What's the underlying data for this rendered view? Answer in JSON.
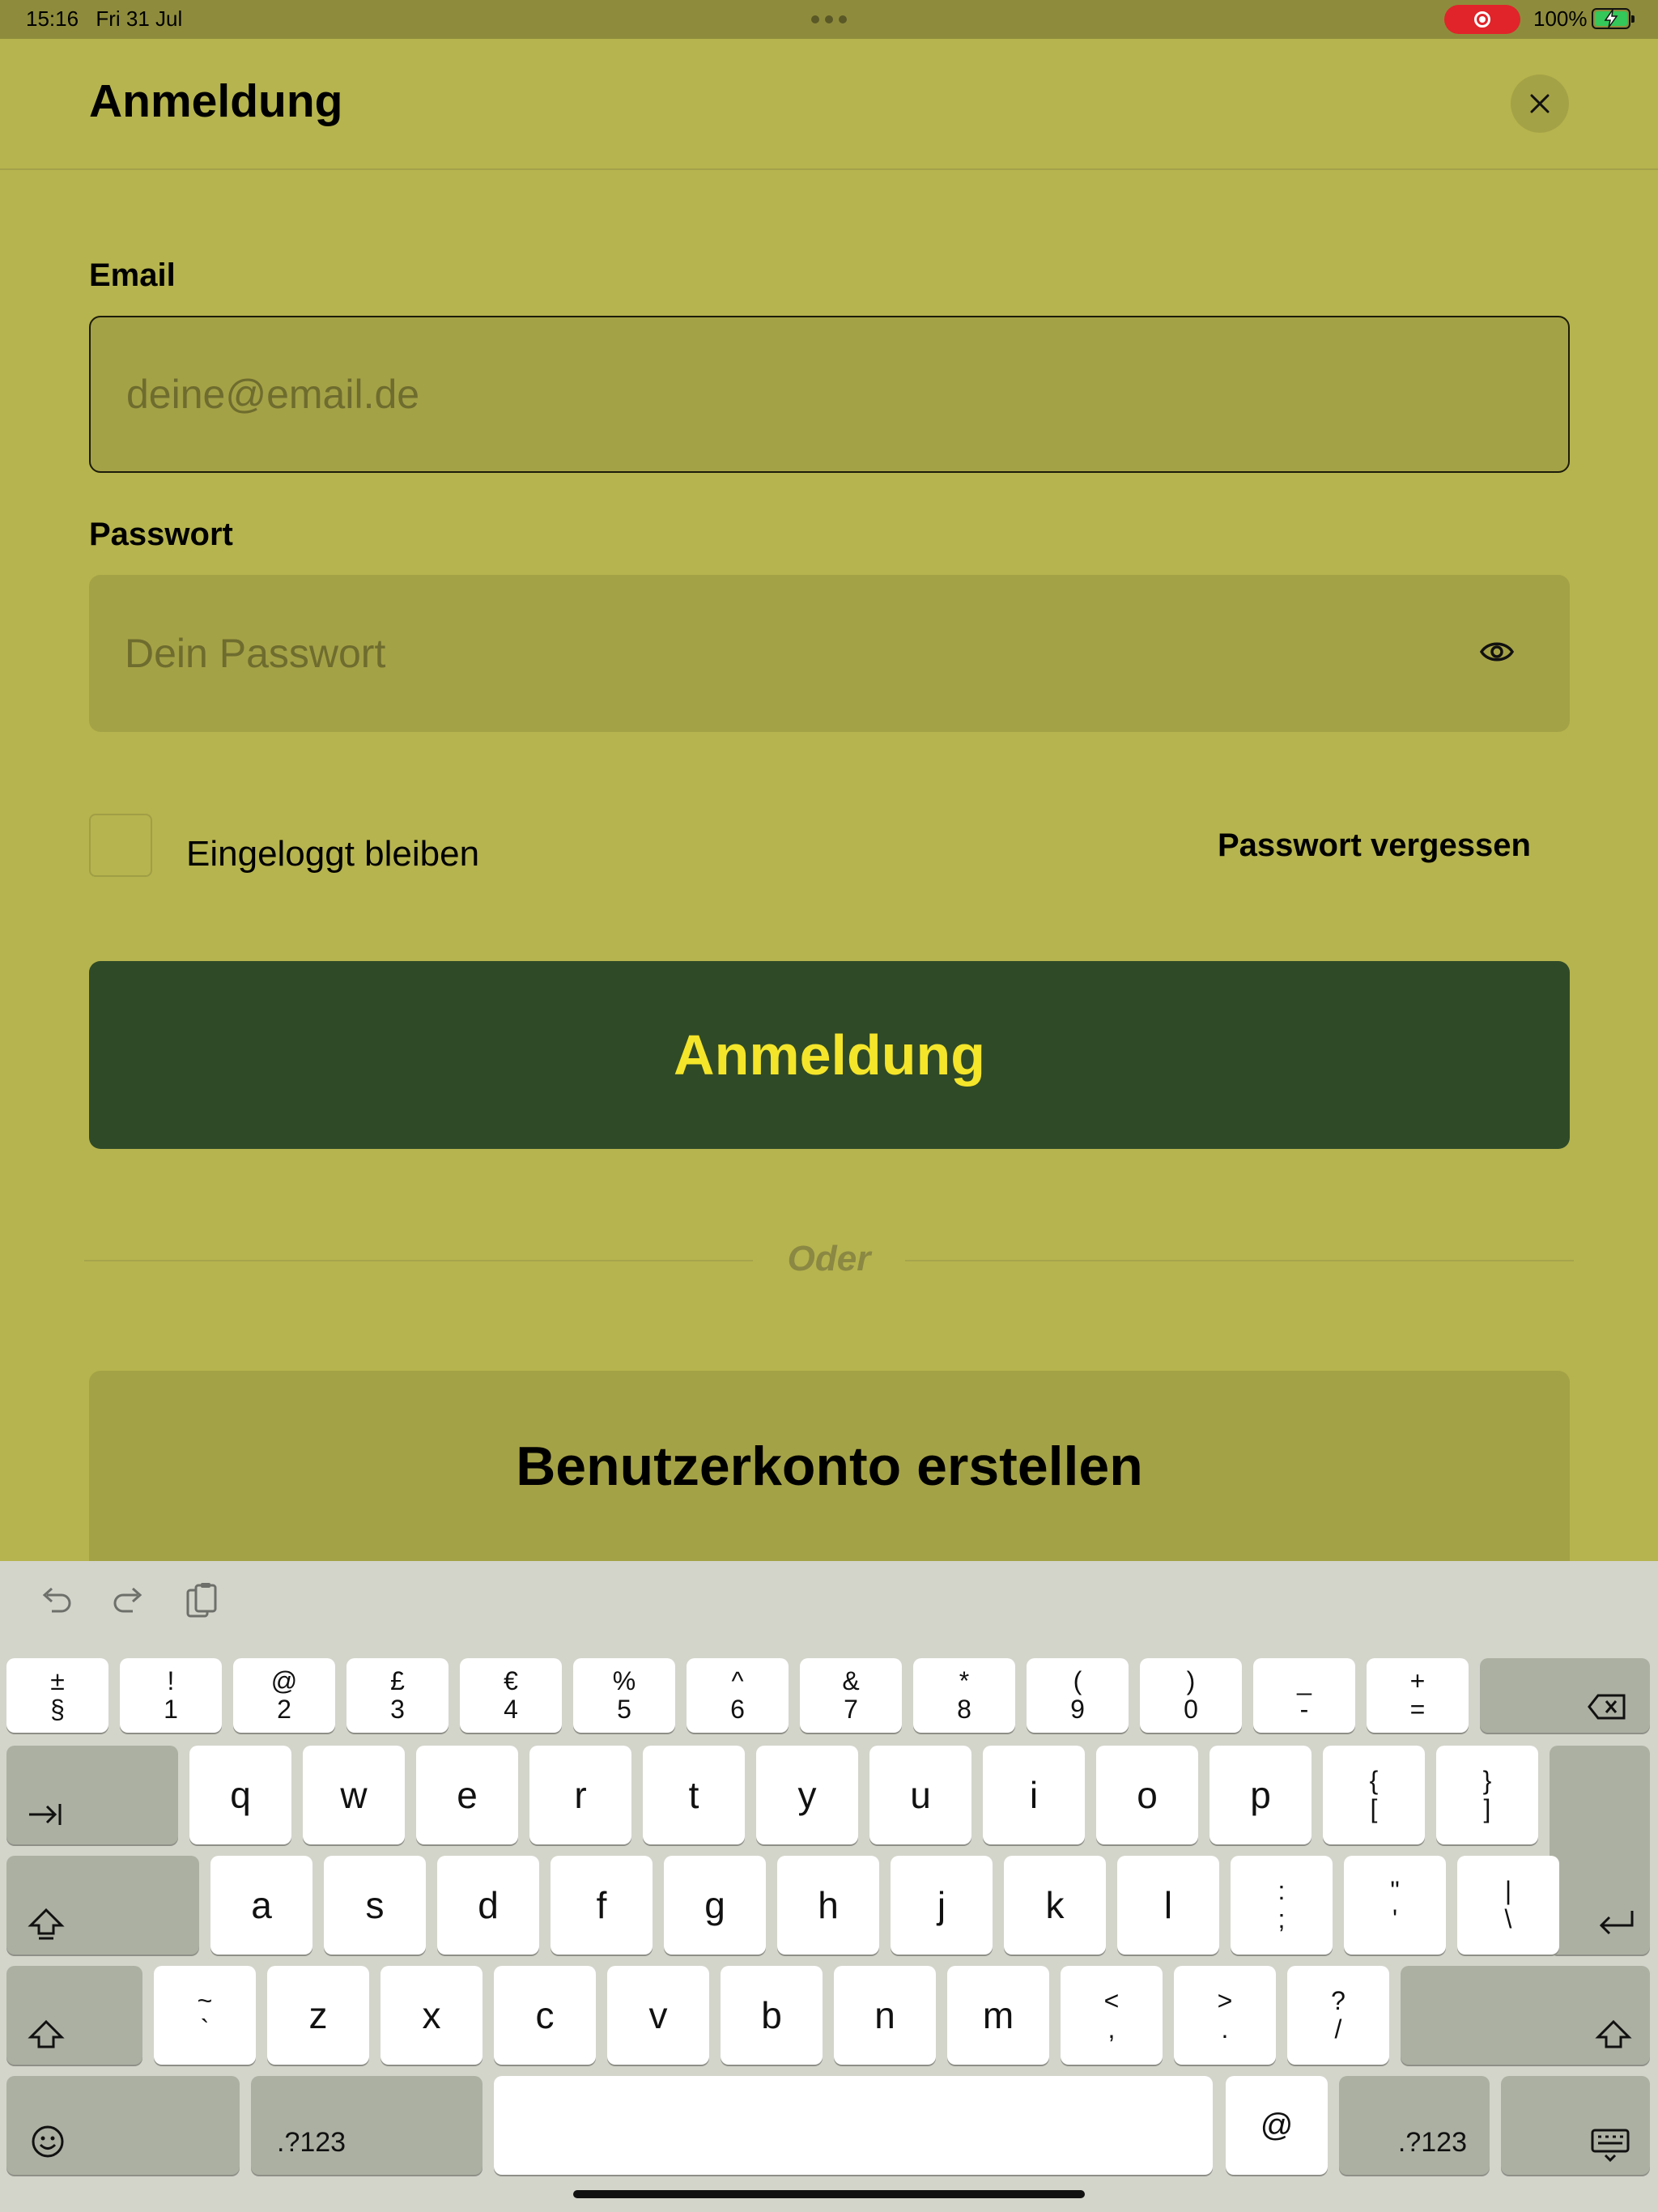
{
  "status": {
    "time": "15:16",
    "date": "Fri 31 Jul",
    "battery": "100%"
  },
  "sheet": {
    "title": "Anmeldung"
  },
  "form": {
    "email_label": "Email",
    "email_placeholder": "deine@email.de",
    "password_label": "Passwort",
    "password_placeholder": "Dein Passwort",
    "remember_label": "Eingeloggt bleiben",
    "forgot_label": "Passwort vergessen",
    "login_label": "Anmeldung",
    "divider_text": "Oder",
    "create_account_label": "Benutzerkonto erstellen"
  },
  "keyboard": {
    "number_row": [
      {
        "top": "±",
        "bottom": "§"
      },
      {
        "top": "!",
        "bottom": "1"
      },
      {
        "top": "@",
        "bottom": "2"
      },
      {
        "top": "£",
        "bottom": "3"
      },
      {
        "top": "€",
        "bottom": "4"
      },
      {
        "top": "%",
        "bottom": "5"
      },
      {
        "top": "^",
        "bottom": "6"
      },
      {
        "top": "&",
        "bottom": "7"
      },
      {
        "top": "*",
        "bottom": "8"
      },
      {
        "top": "(",
        "bottom": "9"
      },
      {
        "top": ")",
        "bottom": "0"
      },
      {
        "top": "_",
        "bottom": "-"
      },
      {
        "top": "+",
        "bottom": "="
      }
    ],
    "row_q": [
      "q",
      "w",
      "e",
      "r",
      "t",
      "y",
      "u",
      "i",
      "o",
      "p"
    ],
    "row_q_extra": [
      {
        "top": "{",
        "bottom": "["
      },
      {
        "top": "}",
        "bottom": "]"
      }
    ],
    "row_a": [
      "a",
      "s",
      "d",
      "f",
      "g",
      "h",
      "j",
      "k",
      "l"
    ],
    "row_a_extra": [
      {
        "top": ":",
        "bottom": ";"
      },
      {
        "top": "\"",
        "bottom": "'"
      },
      {
        "top": "|",
        "bottom": "\\"
      }
    ],
    "row_z_first": {
      "top": "~",
      "bottom": "`"
    },
    "row_z": [
      "z",
      "x",
      "c",
      "v",
      "b",
      "n",
      "m"
    ],
    "row_z_extra": [
      {
        "top": "<",
        "bottom": ","
      },
      {
        "top": ">",
        "bottom": "."
      },
      {
        "top": "?",
        "bottom": "/"
      }
    ],
    "numbers_label": ".?123",
    "at_label": "@"
  }
}
